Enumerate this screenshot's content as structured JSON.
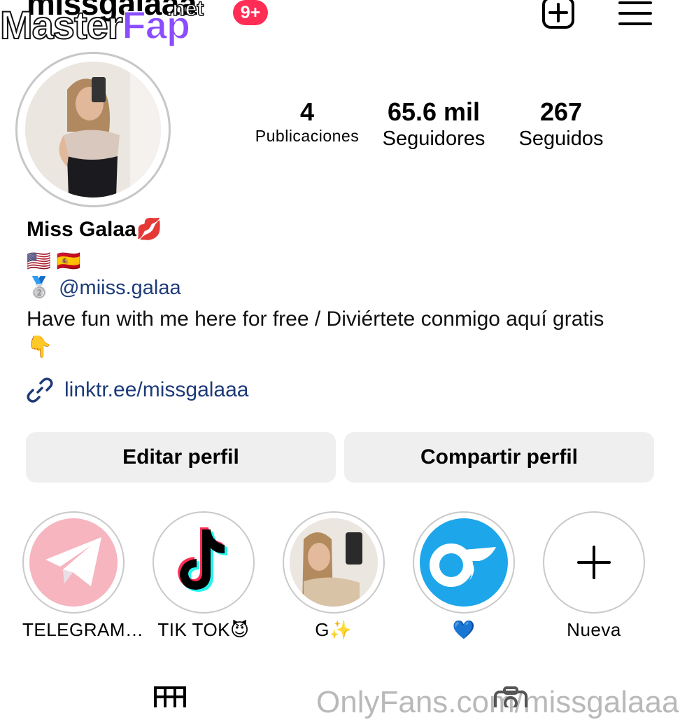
{
  "header": {
    "username": "missgalaaa",
    "notifications_badge": "9+",
    "watermark_main_1": "Master",
    "watermark_main_2": "Fap",
    "watermark_suffix": ".net"
  },
  "profile": {
    "name": "Miss Galaa💋",
    "flags": "🇺🇸 🇪🇸",
    "threads_emoji": "🥈",
    "threads_handle": "@miiss.galaa",
    "bio": "Have fun with me here for free / Diviértete conmigo aquí gratis 👇",
    "link": "linktr.ee/missgalaaa"
  },
  "stats": [
    {
      "value": "4",
      "label": "Publicaciones"
    },
    {
      "value": "65.6 mil",
      "label": "Seguidores"
    },
    {
      "value": "267",
      "label": "Seguidos"
    }
  ],
  "buttons": {
    "edit": "Editar perfil",
    "share": "Compartir perfil"
  },
  "highlights": [
    {
      "label": "TELEGRAM…",
      "icon": "telegram-icon"
    },
    {
      "label": "TIK TOK😈",
      "icon": "tiktok-icon"
    },
    {
      "label": "G✨",
      "icon": "photo"
    },
    {
      "label": "💙",
      "icon": "onlyfans-icon"
    },
    {
      "label": "Nueva",
      "icon": "plus-icon"
    }
  ],
  "bottom": {
    "overlay_text": "OnlyFans.com/missgalaaa"
  },
  "colors": {
    "badge": "#ff2d55",
    "link": "#1d3b78",
    "button_bg": "#efefef",
    "telegram_bg": "#f6b5bf",
    "onlyfans_bg": "#1ea6ea"
  }
}
